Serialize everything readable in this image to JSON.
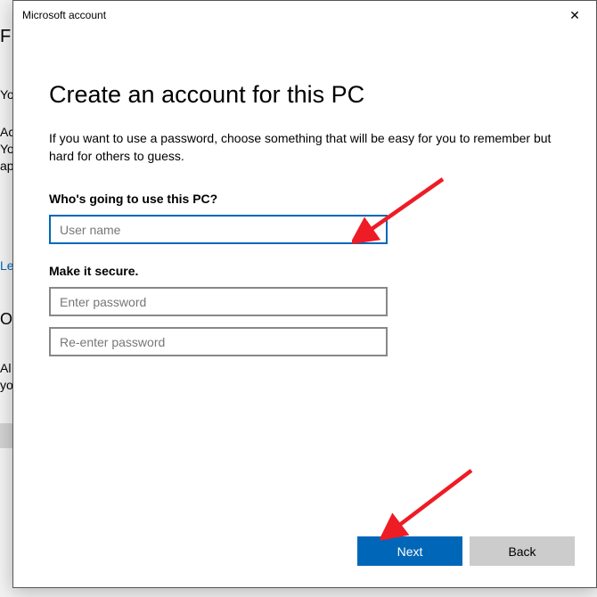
{
  "backgroundFragments": {
    "f1": "F",
    "f2": "Yo",
    "f3": "Ac",
    "f4": "Yo",
    "f5": "ap",
    "f6": "Le",
    "f7": "O",
    "f8": "Al",
    "f9": "yo"
  },
  "titlebar": {
    "title": "Microsoft account",
    "close": "✕"
  },
  "main": {
    "heading": "Create an account for this PC",
    "description": "If you want to use a password, choose something that will be easy for you to remember but hard for others to guess.",
    "section1_label": "Who's going to use this PC?",
    "username_placeholder": "User name",
    "section2_label": "Make it secure.",
    "password_placeholder": "Enter password",
    "password2_placeholder": "Re-enter password"
  },
  "buttons": {
    "next": "Next",
    "back": "Back"
  }
}
